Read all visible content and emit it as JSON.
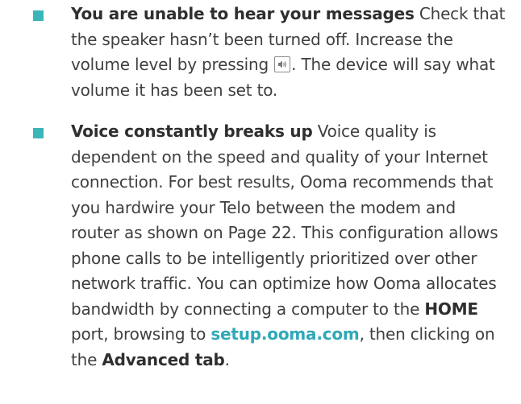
{
  "items": [
    {
      "heading": "You are unable to hear your messages",
      "text_1": " Check that the speaker hasn’t been turned off. Increase the volume level by pressing ",
      "icon": "volume-icon",
      "text_2": ". The device will say what volume it has been set to."
    },
    {
      "heading": "Voice constantly breaks up",
      "text_1": " Voice quality is dependent on the speed and quality of your Internet connection. For best results, Ooma recommends that you hardwire your Telo between the modem and router as shown on Page 22. This configuration allows phone calls to be intelligently prioritized over other network traffic. You can optimize how Ooma allocates bandwidth by connecting a computer to the ",
      "home": "HOME",
      "text_2": " port, browsing to ",
      "link": "setup.ooma.com",
      "text_3": ", then clicking on the ",
      "advanced": "Advanced tab",
      "text_4": "."
    }
  ],
  "colors": {
    "bullet": "#3bb6b8",
    "link": "#2fa8b8",
    "text": "#3f3f3f"
  }
}
